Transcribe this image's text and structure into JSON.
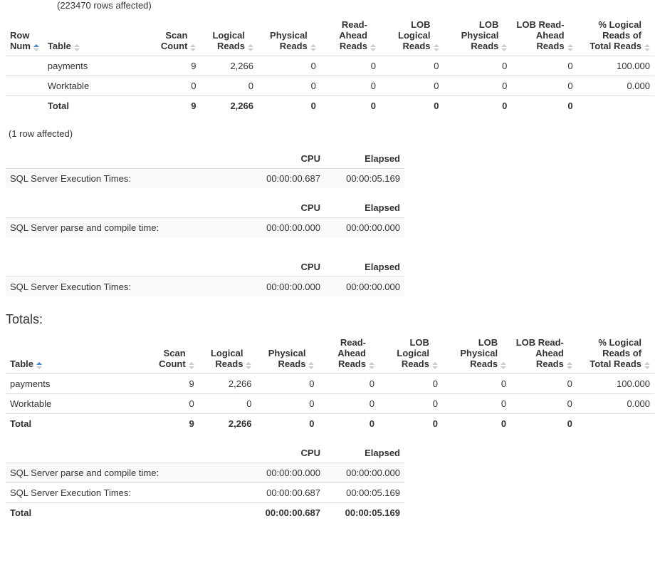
{
  "rows_affected_1": "(223470 rows affected)",
  "rows_affected_2": "(1 row affected)",
  "stats_headers": {
    "row_num": "Row Num",
    "table": "Table",
    "scan_count": "Scan Count",
    "logical_reads": "Logical Reads",
    "physical_reads": "Physical Reads",
    "read_ahead": "Read-Ahead Reads",
    "lob_logical": "LOB Logical Reads",
    "lob_physical": "LOB Physical Reads",
    "lob_read_ahead": "LOB Read-Ahead Reads",
    "pct_logical": "% Logical Reads of Total Reads"
  },
  "stats_rows": [
    {
      "row": "",
      "table": "payments",
      "scan": "9",
      "logical": "2,266",
      "physical": "0",
      "readahead": "0",
      "loblogical": "0",
      "lobphysical": "0",
      "lobreadahead": "0",
      "pct": "100.000"
    },
    {
      "row": "",
      "table": "Worktable",
      "scan": "0",
      "logical": "0",
      "physical": "0",
      "readahead": "0",
      "loblogical": "0",
      "lobphysical": "0",
      "lobreadahead": "0",
      "pct": "0.000"
    }
  ],
  "stats_total": {
    "table": "Total",
    "scan": "9",
    "logical": "2,266",
    "physical": "0",
    "readahead": "0",
    "loblogical": "0",
    "lobphysical": "0",
    "lobreadahead": "0",
    "pct": ""
  },
  "time_headers": {
    "cpu": "CPU",
    "elapsed": "Elapsed"
  },
  "time_tables": [
    {
      "rows": [
        {
          "label": "SQL Server Execution Times:",
          "cpu": "00:00:00.687",
          "elapsed": "00:00:05.169"
        }
      ]
    },
    {
      "rows": [
        {
          "label": "SQL Server parse and compile time:",
          "cpu": "00:00:00.000",
          "elapsed": "00:00:00.000"
        }
      ]
    },
    {
      "rows": [
        {
          "label": "SQL Server Execution Times:",
          "cpu": "00:00:00.000",
          "elapsed": "00:00:00.000"
        }
      ]
    }
  ],
  "totals_heading": "Totals:",
  "totals_rows": [
    {
      "table": "payments",
      "scan": "9",
      "logical": "2,266",
      "physical": "0",
      "readahead": "0",
      "loblogical": "0",
      "lobphysical": "0",
      "lobreadahead": "0",
      "pct": "100.000"
    },
    {
      "table": "Worktable",
      "scan": "0",
      "logical": "0",
      "physical": "0",
      "readahead": "0",
      "loblogical": "0",
      "lobphysical": "0",
      "lobreadahead": "0",
      "pct": "0.000"
    }
  ],
  "totals_sum": {
    "table": "Total",
    "scan": "9",
    "logical": "2,266",
    "physical": "0",
    "readahead": "0",
    "loblogical": "0",
    "lobphysical": "0",
    "lobreadahead": "0",
    "pct": ""
  },
  "totals_time_rows": [
    {
      "label": "SQL Server parse and compile time:",
      "cpu": "00:00:00.000",
      "elapsed": "00:00:00.000"
    },
    {
      "label": "SQL Server Execution Times:",
      "cpu": "00:00:00.687",
      "elapsed": "00:00:05.169"
    }
  ],
  "totals_time_total": {
    "label": "Total",
    "cpu": "00:00:00.687",
    "elapsed": "00:00:05.169"
  }
}
